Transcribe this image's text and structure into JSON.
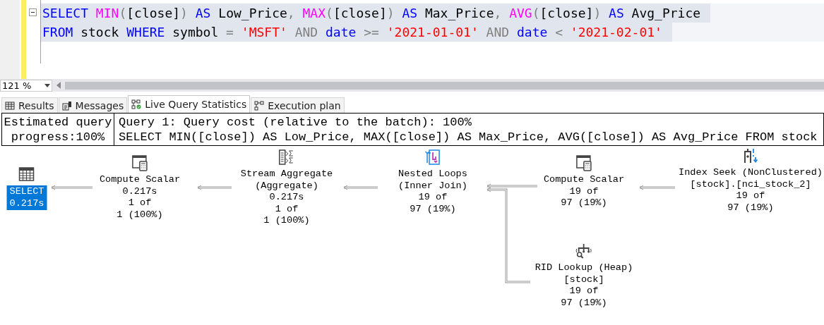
{
  "editor": {
    "lines": [
      {
        "tokens": [
          {
            "text": "SELECT ",
            "kind": "keyword"
          },
          {
            "text": "MIN",
            "kind": "function"
          },
          {
            "text": "(",
            "kind": "operator"
          },
          {
            "text": "[close]",
            "kind": "plain"
          },
          {
            "text": ") ",
            "kind": "operator"
          },
          {
            "text": "AS",
            "kind": "keyword"
          },
          {
            "text": " Low_Price",
            "kind": "plain"
          },
          {
            "text": ", ",
            "kind": "operator"
          },
          {
            "text": "MAX",
            "kind": "function"
          },
          {
            "text": "(",
            "kind": "operator"
          },
          {
            "text": "[close]",
            "kind": "plain"
          },
          {
            "text": ") ",
            "kind": "operator"
          },
          {
            "text": "AS",
            "kind": "keyword"
          },
          {
            "text": " Max_Price",
            "kind": "plain"
          },
          {
            "text": ", ",
            "kind": "operator"
          },
          {
            "text": "AVG",
            "kind": "function"
          },
          {
            "text": "(",
            "kind": "operator"
          },
          {
            "text": "[close]",
            "kind": "plain"
          },
          {
            "text": ") ",
            "kind": "operator"
          },
          {
            "text": "AS",
            "kind": "keyword"
          },
          {
            "text": " Avg_Price",
            "kind": "plain"
          }
        ]
      },
      {
        "tokens": [
          {
            "text": "FROM",
            "kind": "keyword"
          },
          {
            "text": " stock ",
            "kind": "plain"
          },
          {
            "text": "WHERE",
            "kind": "keyword"
          },
          {
            "text": " symbol ",
            "kind": "plain"
          },
          {
            "text": "= ",
            "kind": "operator"
          },
          {
            "text": "'MSFT'",
            "kind": "string"
          },
          {
            "text": " AND ",
            "kind": "operator"
          },
          {
            "text": "date",
            "kind": "keyword"
          },
          {
            "text": " >= ",
            "kind": "operator"
          },
          {
            "text": "'2021-01-01'",
            "kind": "string"
          },
          {
            "text": " AND ",
            "kind": "operator"
          },
          {
            "text": "date",
            "kind": "keyword"
          },
          {
            "text": " < ",
            "kind": "operator"
          },
          {
            "text": "'2021-02-01'",
            "kind": "string"
          }
        ]
      }
    ]
  },
  "zoom": {
    "value": "121 %"
  },
  "tabs": [
    {
      "label": "Results",
      "kind": "grid",
      "selected": false
    },
    {
      "label": "Messages",
      "kind": "messages",
      "selected": false
    },
    {
      "label": "Live Query Statistics",
      "kind": "live",
      "selected": true
    },
    {
      "label": "Execution plan",
      "kind": "plan",
      "selected": false
    }
  ],
  "plan_header": {
    "progress_label": "Estimated query",
    "progress_value": "progress:100%",
    "query_cost": "Query 1: Query cost (relative to the batch): 100%",
    "query_text": "SELECT MIN([close]) AS Low_Price, MAX([close]) AS Max_Price, AVG([close]) AS Avg_Price FROM stock"
  },
  "plan_nodes": [
    {
      "kind": "select",
      "lines": [
        "SELECT",
        "0.217s"
      ],
      "selected": true
    },
    {
      "kind": "compute",
      "lines": [
        "Compute Scalar",
        "0.217s",
        "1 of",
        "1 (100%)"
      ],
      "selected": false
    },
    {
      "kind": "aggregate",
      "lines": [
        "Stream Aggregate",
        "(Aggregate)",
        "0.217s",
        "1 of",
        "1 (100%)"
      ],
      "selected": false
    },
    {
      "kind": "loops",
      "lines": [
        "Nested Loops",
        "(Inner Join)",
        "19 of",
        "97 (19%)"
      ],
      "selected": false
    },
    {
      "kind": "compute",
      "lines": [
        "Compute Scalar",
        "19 of",
        "97 (19%)"
      ],
      "selected": false
    },
    {
      "kind": "seek",
      "lines": [
        "Index Seek (NonClustered)",
        "[stock].[nci_stock_2]",
        "19 of",
        "97 (19%)"
      ],
      "selected": false
    },
    {
      "kind": "lookup",
      "lines": [
        "RID Lookup (Heap)",
        "[stock]",
        "19 of",
        "97 (19%)"
      ],
      "selected": false
    }
  ]
}
